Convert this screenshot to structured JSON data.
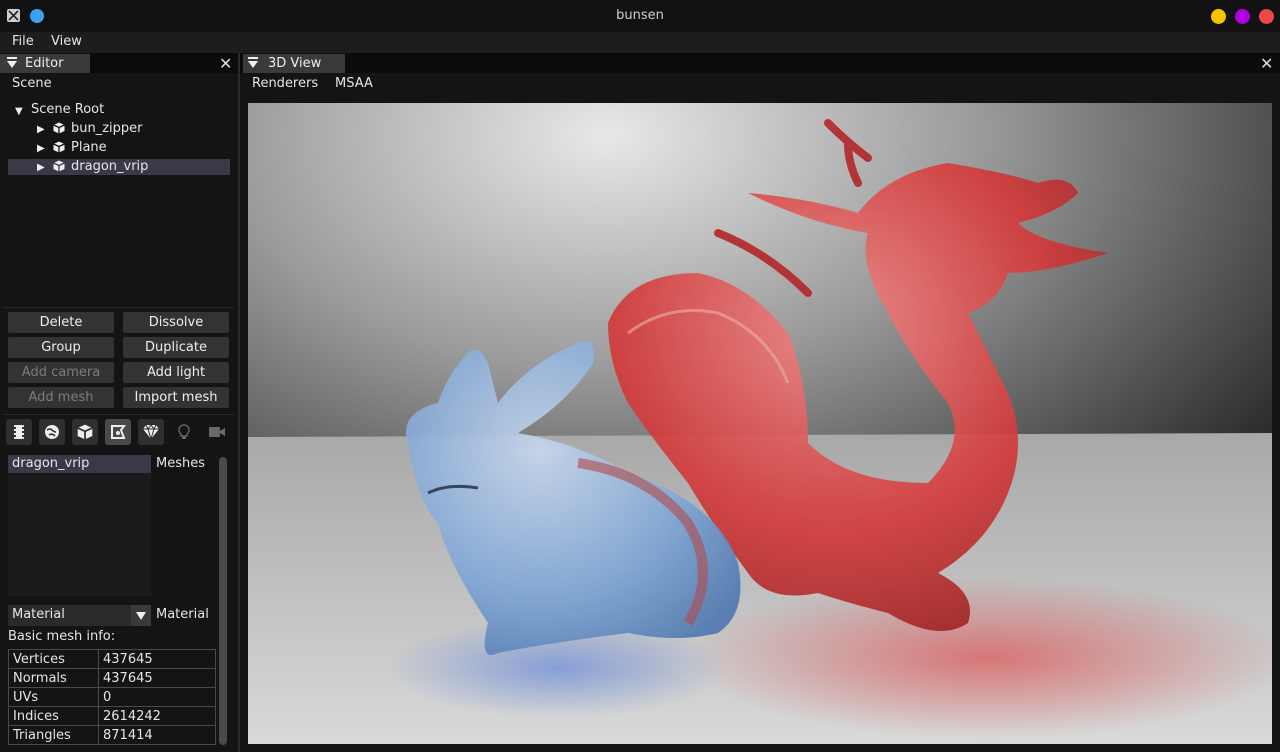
{
  "window": {
    "title": "bunsen",
    "dots": {
      "yellow": "#f5c400",
      "purple": "#b000e0",
      "red": "#f04848"
    },
    "logo_color": "#3aa0f0"
  },
  "menubar": {
    "items": [
      "File",
      "View"
    ]
  },
  "editor": {
    "tab_label": "Editor",
    "section_label": "Scene",
    "tree": {
      "root": "Scene Root",
      "items": [
        "bun_zipper",
        "Plane",
        "dragon_vrip"
      ],
      "selected": "dragon_vrip"
    },
    "buttons": {
      "delete": "Delete",
      "dissolve": "Dissolve",
      "group": "Group",
      "duplicate": "Duplicate",
      "add_camera": "Add camera",
      "add_light": "Add light",
      "add_mesh": "Add mesh",
      "import_mesh": "Import mesh"
    },
    "toolbar_icons": [
      "film-icon",
      "globe-icon",
      "cube-icon",
      "node-icon",
      "gem-icon",
      "lightbulb-icon",
      "camera-icon"
    ],
    "mesh_list": {
      "items": [
        "dragon_vrip"
      ],
      "label": "Meshes"
    },
    "material": {
      "value": "Material",
      "label": "Material"
    },
    "info_title": "Basic mesh info:",
    "info_rows": [
      {
        "name": "Vertices",
        "value": "437645"
      },
      {
        "name": "Normals",
        "value": "437645"
      },
      {
        "name": "UVs",
        "value": "0"
      },
      {
        "name": "Indices",
        "value": "2614242"
      },
      {
        "name": "Triangles",
        "value": "871414"
      }
    ]
  },
  "view3d": {
    "tab_label": "3D View",
    "menu": [
      "Renderers",
      "MSAA"
    ],
    "colors": {
      "bunny": "#7fa6d6",
      "dragon": "#d23a3a"
    }
  }
}
